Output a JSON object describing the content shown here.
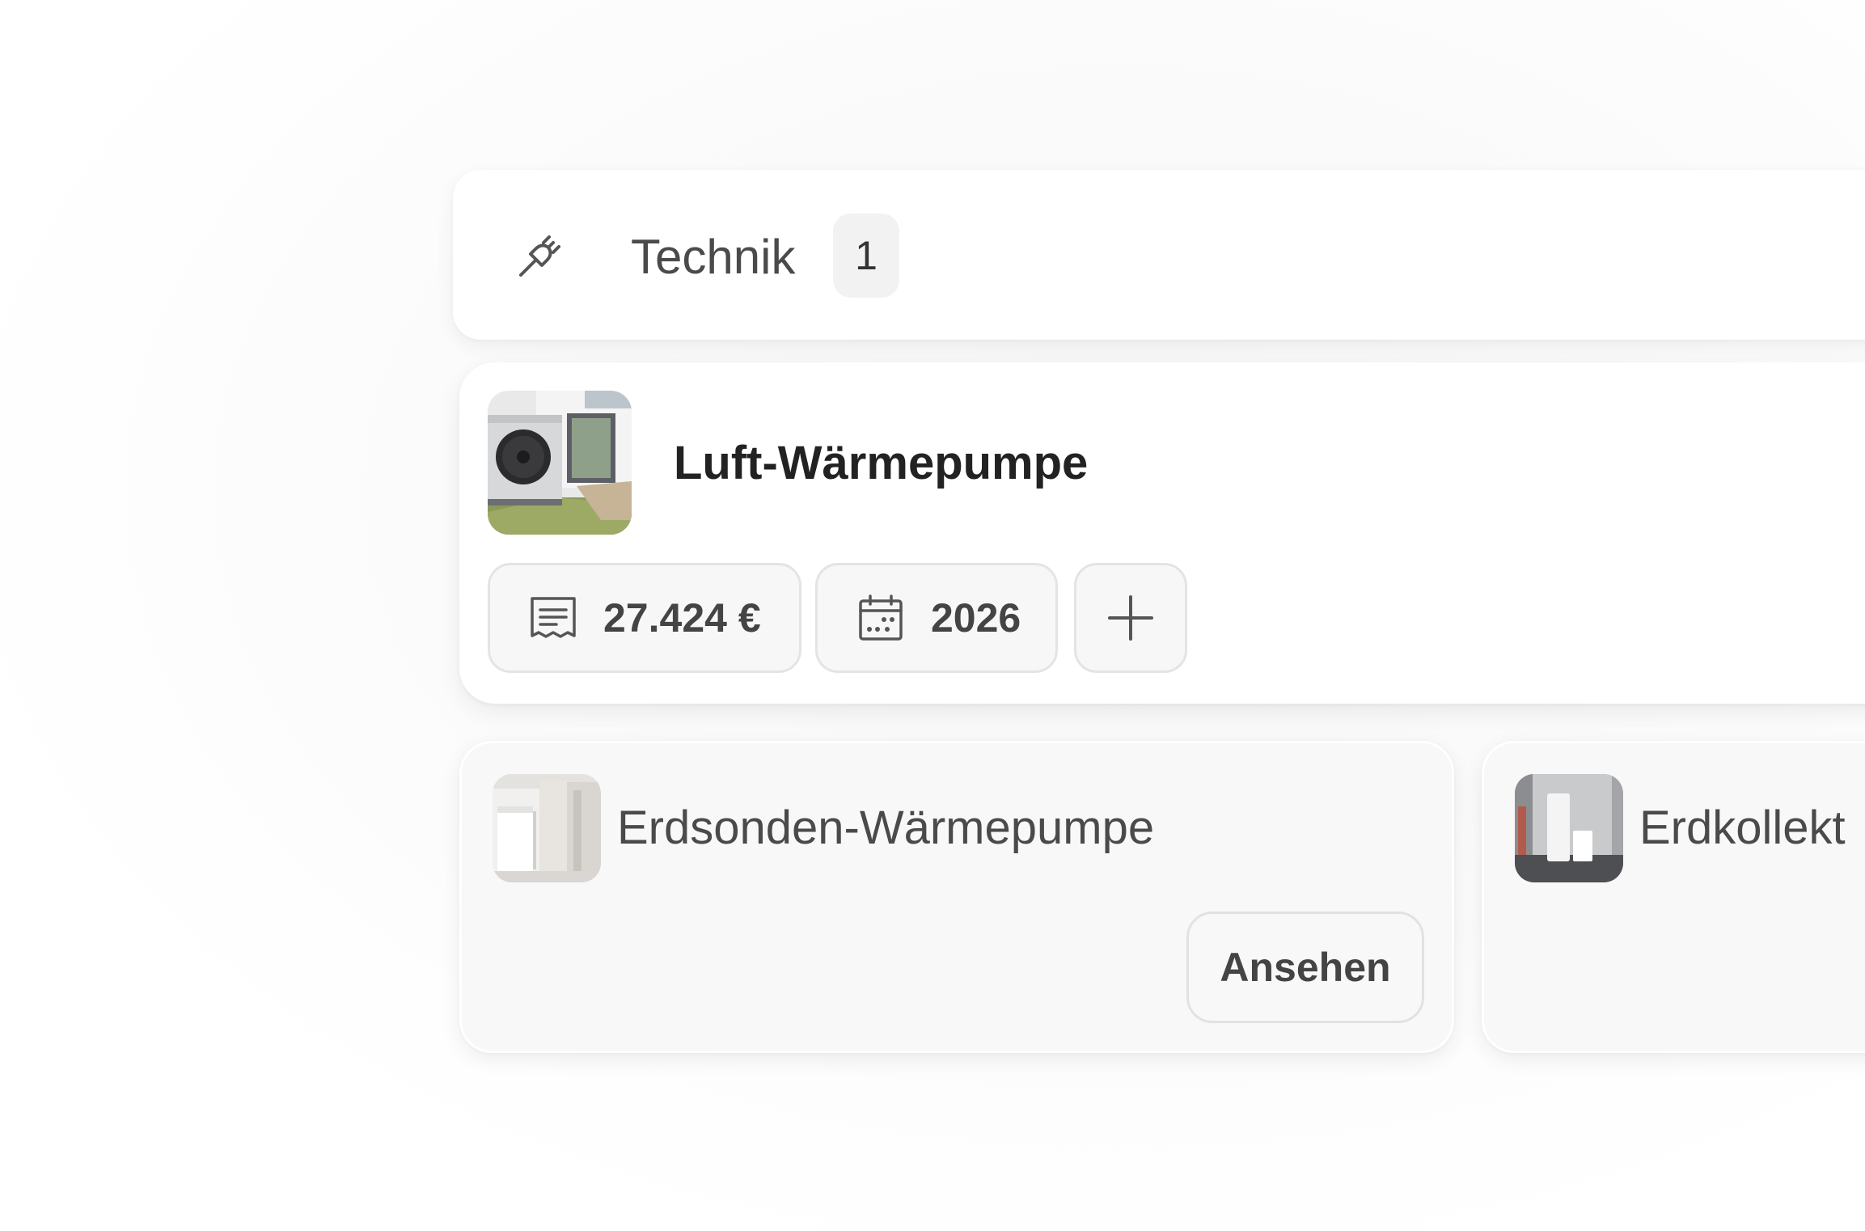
{
  "category": {
    "icon": "plug-icon",
    "title": "Technik",
    "count": "1"
  },
  "selected_item": {
    "image": "air-heat-pump-photo",
    "title": "Luft-Wärmepumpe",
    "price_icon": "receipt-icon",
    "price": "27.424 €",
    "year_icon": "calendar-icon",
    "year": "2026",
    "add_icon": "plus-icon"
  },
  "alternatives": [
    {
      "image": "ground-probe-heat-pump-photo",
      "title": "Erdsonden-Wärmepumpe",
      "button_label": "Ansehen"
    },
    {
      "image": "ground-collector-heat-pump-photo",
      "title": "Erdkollekt"
    }
  ],
  "colors": {
    "card_background": "#ffffff",
    "chip_background": "#f7f7f7",
    "chip_border": "#e4e4e4",
    "text_primary": "#222222",
    "text_secondary": "#4a4a4a"
  }
}
